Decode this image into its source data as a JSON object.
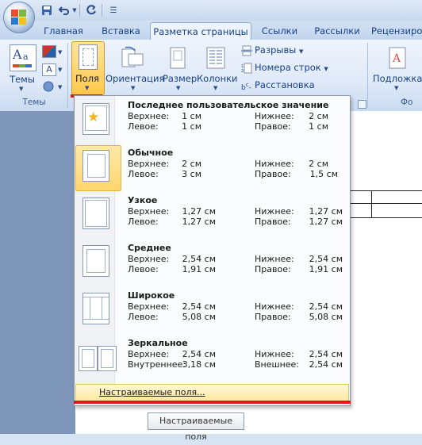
{
  "tabs": [
    "Главная",
    "Вставка",
    "Разметка страницы",
    "Ссылки",
    "Рассылки",
    "Рецензиро"
  ],
  "active_tab": "Разметка страницы",
  "ribbon": {
    "themes_label": "Темы",
    "themes_group": "Темы",
    "fields_label": "Поля",
    "orientation_label": "Ориентация",
    "size_label": "Размер",
    "columns_label": "Колонки",
    "breaks_label": "Разрывы",
    "line_numbers_label": "Номера строк",
    "hyphenation_label": "Расстановка переносов",
    "substrate_label": "Подложка",
    "right_group_label": "Фо"
  },
  "menu": {
    "items": [
      {
        "title": "Последнее пользовательское значение",
        "top_label": "Верхнее:",
        "top_value": "1 см",
        "bottom_label": "Нижнее:",
        "bottom_value": "2 см",
        "left_label": "Левое:",
        "left_value": "1 см",
        "right_label": "Правое:",
        "right_value": "1 см"
      },
      {
        "title": "Обычное",
        "top_label": "Верхнее:",
        "top_value": "2 см",
        "bottom_label": "Нижнее:",
        "bottom_value": "2 см",
        "left_label": "Левое:",
        "left_value": "3 см",
        "right_label": "Правое:",
        "right_value": "1,5 см"
      },
      {
        "title": "Узкое",
        "top_label": "Верхнее:",
        "top_value": "1,27 см",
        "bottom_label": "Нижнее:",
        "bottom_value": "1,27 см",
        "left_label": "Левое:",
        "left_value": "1,27 см",
        "right_label": "Правое:",
        "right_value": "1,27 см"
      },
      {
        "title": "Среднее",
        "top_label": "Верхнее:",
        "top_value": "2,54 см",
        "bottom_label": "Нижнее:",
        "bottom_value": "2,54 см",
        "left_label": "Левое:",
        "left_value": "1,91 см",
        "right_label": "Правое:",
        "right_value": "1,91 см"
      },
      {
        "title": "Широкое",
        "top_label": "Верхнее:",
        "top_value": "2,54 см",
        "bottom_label": "Нижнее:",
        "bottom_value": "2,54 см",
        "left_label": "Левое:",
        "left_value": "5,08 см",
        "right_label": "Правое:",
        "right_value": "5,08 см"
      },
      {
        "title": "Зеркальное",
        "top_label": "Верхнее:",
        "top_value": "2,54 см",
        "bottom_label": "Нижнее:",
        "bottom_value": "2,54 см",
        "left_label": "Внутреннее:",
        "left_value": "3,18 см",
        "right_label": "Внешнее:",
        "right_value": "2,54 см"
      }
    ],
    "custom_fields_label": "Настраиваемые поля...",
    "tooltip": "Настраиваемые поля"
  },
  "colors": {
    "accent_red": "#e0161a",
    "highlight": "#ffd66e",
    "ribbon_text": "#15428b"
  }
}
